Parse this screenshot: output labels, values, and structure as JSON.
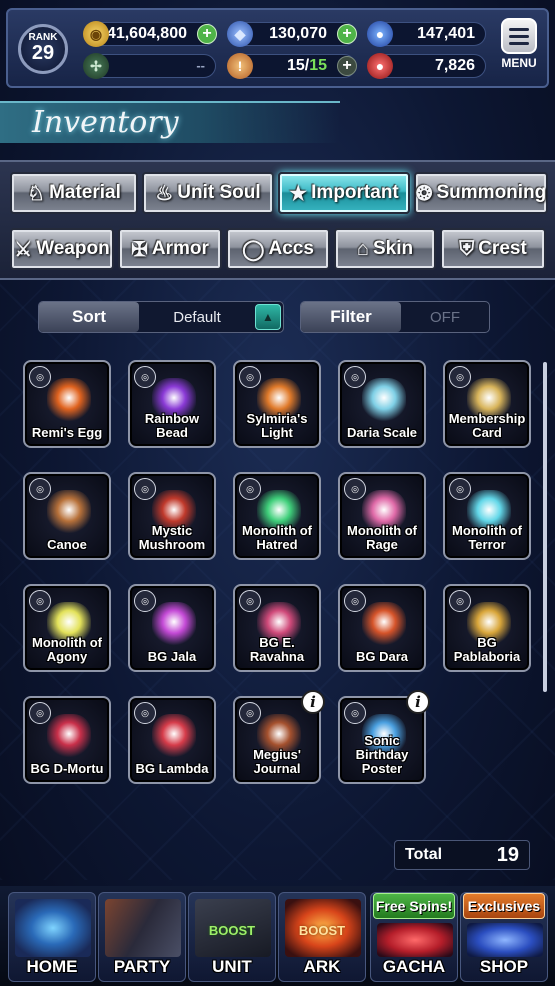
{
  "header": {
    "rank_label": "RANK",
    "rank_value": "29",
    "gil": "41,604,800",
    "lapis": "130,070",
    "visions": "147,401",
    "arena": "--",
    "stamina": "15",
    "stamina_max": "15",
    "orbs": "7,826",
    "menu_label": "MENU"
  },
  "title": "Inventory",
  "tabs_row1": [
    {
      "label": "Material",
      "icon": "sack-icon"
    },
    {
      "label": "Unit Soul",
      "icon": "flame-icon"
    },
    {
      "label": "Important",
      "icon": "star-icon"
    },
    {
      "label": "Summoning",
      "icon": "orb-icon"
    }
  ],
  "tabs_row2": [
    {
      "label": "Weapon",
      "icon": "sword-icon"
    },
    {
      "label": "Armor",
      "icon": "armor-icon"
    },
    {
      "label": "Accs",
      "icon": "ring-icon"
    },
    {
      "label": "Skin",
      "icon": "hanger-icon"
    },
    {
      "label": "Crest",
      "icon": "crest-icon"
    }
  ],
  "sort": {
    "label": "Sort",
    "value": "Default"
  },
  "filter": {
    "label": "Filter",
    "value": "OFF"
  },
  "items": [
    {
      "name": "Remi's Egg",
      "color": "#e0631f"
    },
    {
      "name": "Rainbow Bead",
      "color": "#8a3ad6"
    },
    {
      "name": "Sylmiria's Light",
      "color": "#e07a2a"
    },
    {
      "name": "Daria Scale",
      "color": "#7fd0e6"
    },
    {
      "name": "Membership Card",
      "color": "#d8b45a"
    },
    {
      "name": "Canoe",
      "color": "#b7713a"
    },
    {
      "name": "Mystic Mushroom",
      "color": "#c0392b"
    },
    {
      "name": "Monolith of Hatred",
      "color": "#3fcf7a"
    },
    {
      "name": "Monolith of Rage",
      "color": "#e06aa8"
    },
    {
      "name": "Monolith of Terror",
      "color": "#62d7e8"
    },
    {
      "name": "Monolith of Agony",
      "color": "#e3e25a"
    },
    {
      "name": "BG Jala",
      "color": "#c44ad6"
    },
    {
      "name": "BG E. Ravahna",
      "color": "#d04a7a"
    },
    {
      "name": "BG Dara",
      "color": "#d6542a"
    },
    {
      "name": "BG Pablaboria",
      "color": "#d9a63a"
    },
    {
      "name": "BG D-Mortu",
      "color": "#c9304a"
    },
    {
      "name": "BG Lambda",
      "color": "#d63c4a"
    },
    {
      "name": "Megius' Journal",
      "color": "#a5512e"
    },
    {
      "name": "Sonic Birthday Poster",
      "color": "#4aa0e0"
    }
  ],
  "total": {
    "label": "Total",
    "value": "19"
  },
  "nav": [
    {
      "label": "HOME"
    },
    {
      "label": "PARTY"
    },
    {
      "label": "UNIT",
      "boost": "BOOST"
    },
    {
      "label": "ARK",
      "boost": "BOOST"
    },
    {
      "label": "GACHA",
      "tag": "Free Spins!"
    },
    {
      "label": "SHOP",
      "tag": "Exclusives"
    }
  ],
  "colors": {
    "accent": "#3db9c6",
    "panel": "#1b2238",
    "gold": "#e6b64a"
  }
}
